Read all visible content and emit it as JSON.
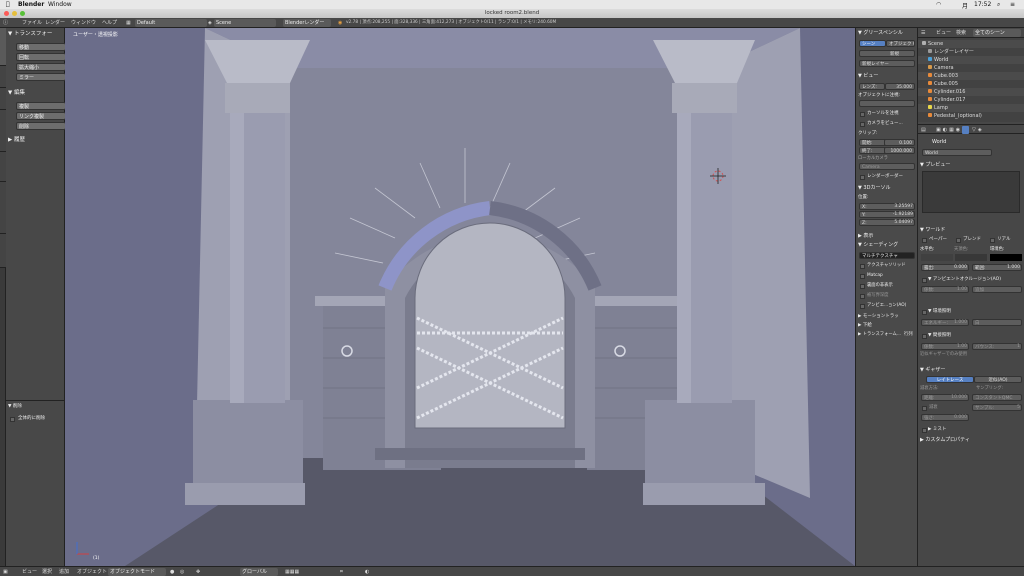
{
  "macbar": {
    "apple_icon": "apple-icon",
    "app": "Blender",
    "menu": "Window",
    "clock": "17:52",
    "day": "月"
  },
  "window": {
    "title": "locked room2.blend"
  },
  "header": {
    "menus": [
      "ファイル",
      "レンダー",
      "ウィンドウ",
      "ヘルプ"
    ],
    "layout": "Default",
    "scene": "Scene",
    "engine": "Blenderレンダー",
    "stats": "v2.78 | 頂点:208,255 | 面:328,336 | 三角面:412,273 | オブジェクト0/11 | ランプ:0/1 | メモリ:240.60M"
  },
  "toolshelf": {
    "tabs": [
      "ツール",
      "作成",
      "関係",
      "アニメーション",
      "物理演算",
      "グリースペンシル",
      "Archimesh"
    ],
    "transform_head": "▼ トランスフォー",
    "transform_btns": [
      "移動",
      "回転",
      "拡大縮小",
      "ミラー"
    ],
    "edit_head": "▼ 編集",
    "edit_btns": [
      "複製",
      "リンク複製",
      "削除"
    ],
    "history_head": "▶ 履歴",
    "delete_head": "▼ 削除",
    "delete_global": "全体的に削除"
  },
  "viewport": {
    "label": "ユーザー・透視投影",
    "bottom_label": "(1)"
  },
  "viewport_bar": {
    "items": [
      "ビュー",
      "選択",
      "追加",
      "オブジェクト"
    ],
    "mode": "オブジェクトモード",
    "pivot": "グローバル"
  },
  "props": {
    "grease_head": "▼ グリースペンシル",
    "grease_tabs": [
      "シーン",
      "オブジェクト"
    ],
    "new_btn": "新規",
    "new_layer": "新規レイヤー",
    "view_head": "▼ ビュー",
    "lens": "レンズ:",
    "lens_val": "35.000",
    "lock_obj": "オブジェクトに注視:",
    "lock_cursor": "カーソルを注視",
    "cam_view": "カメラをビュー...",
    "clip_head": "クリップ:",
    "clip_start": "開始:",
    "clip_start_val": "0.100",
    "clip_end": "終了:",
    "clip_end_val": "1000.000",
    "local_cam": "ローカルカメラ",
    "camera": "Camera",
    "render_border": "レンダーボーダー",
    "cursor_head": "▼ 3Dカーソル",
    "location": "位置:",
    "cx": "X:",
    "cx_val": "3.25597",
    "cy": "Y:",
    "cy_val": "-1.92189",
    "cz": "Z:",
    "cz_val": "5.04097",
    "display_head": "▶ 表示",
    "shading_head": "▼ シェーディング",
    "shading_mode": "マルチテクスチャ",
    "shade_opts": [
      "テクスチャソリッド",
      "Matcap",
      "裏面の非表示",
      "被写界深度",
      "アンビエ...ョン(AO)"
    ],
    "motion_head": "▶ モーショントラッ",
    "bg_head": "▶ 下絵",
    "transform_head": "▶ トランスフォーム...",
    "transform_tail": "行列"
  },
  "outliner": {
    "header_items": [
      "ビュー",
      "検索"
    ],
    "header_filter": "全てのシーン",
    "rows": [
      {
        "label": "Scene",
        "color": "#b0b0b0"
      },
      {
        "label": "レンダーレイヤー",
        "color": "#9a9a9a"
      },
      {
        "label": "World",
        "color": "#4aa0d8"
      },
      {
        "label": "Camera",
        "color": "#d89a4a"
      },
      {
        "label": "Cube.003",
        "color": "#e88a3a"
      },
      {
        "label": "Cube.005",
        "color": "#e88a3a"
      },
      {
        "label": "Cylinder.016",
        "color": "#e88a3a"
      },
      {
        "label": "Cylinder.017",
        "color": "#e88a3a"
      },
      {
        "label": "Lamp",
        "color": "#e8d84a"
      },
      {
        "label": "Pedestal_(optional)",
        "color": "#e88a3a"
      }
    ]
  },
  "world": {
    "world_crumb": "World",
    "world_name": "World",
    "preview_head": "▼ プレビュー",
    "world_head": "▼ ワールド",
    "paper": "ペーパー",
    "blend": "ブレンド",
    "real": "リアル",
    "horizon": "水平色:",
    "zenith": "天頂色:",
    "ambient": "環境色:",
    "exposure": "露出:",
    "exposure_val": "0.000",
    "range": "範囲:",
    "range_val": "1.000",
    "ao_head": "▼ アンビエントオクルージョン(AO)",
    "ao_factor": "係数:",
    "ao_factor_val": "1.00",
    "ao_mode": "追加",
    "env_head": "▼ 環境照明",
    "env_energy": "エネルギー:",
    "env_energy_val": "1.000",
    "env_color": "白",
    "indirect_head": "▼ 間接照明",
    "ind_factor": "係数:",
    "ind_factor_val": "1.00",
    "bounce": "バウンス:",
    "bounce_val": "1",
    "ind_note": "近似ギャザーでのみ使用",
    "gather_head": "▼ ギャザー",
    "raytrace": "レイトレース",
    "approx": "近似(AO)",
    "atten": "減衰方法:",
    "sampling": "サンプリング:",
    "distance": "距離:",
    "distance_val": "10.000",
    "qmc": "コンスタントQMC",
    "falloff": "減衰",
    "samples": "サンプル:",
    "samples_val": "5",
    "strength": "強さ:",
    "strength_val": "0.000",
    "mist_head": "▶ ミスト",
    "custom_head": "▶ カスタムプロパティ"
  },
  "colors": {
    "viewport": "#6b6d8a",
    "panel": "#484848",
    "accent": "#5680c2"
  }
}
